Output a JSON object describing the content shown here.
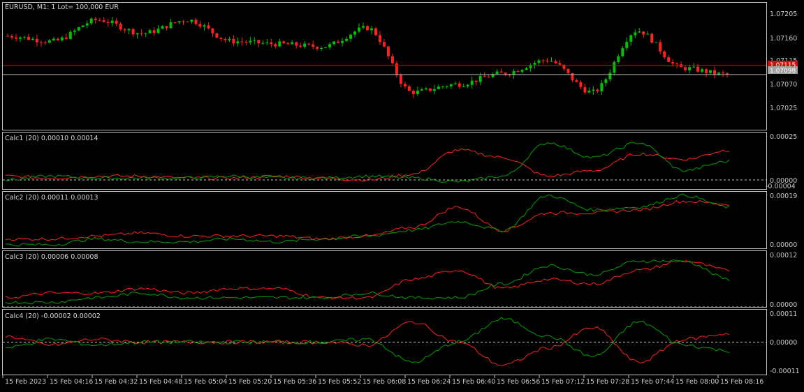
{
  "symbol_header": "EURUSD, M1:  1 Lot= 100,000 EUR",
  "colors": {
    "background": "#000000",
    "frame": "#c0c0c0",
    "bull": "#00c000",
    "bear": "#ff2020",
    "ind_red": "#ff2020",
    "ind_green": "#00a000",
    "bid_line": "#c0c0c0",
    "ask_line": "#d01010",
    "text": "#c8c8c8"
  },
  "main_axis": {
    "ticks": [
      "1.07205",
      "1.07160",
      "1.07115",
      "1.07070",
      "1.07025"
    ],
    "ask_tag": "1.07115",
    "bid_tag": "1.07098"
  },
  "time_axis": [
    "15 Feb 2023",
    "15 Feb 04:16",
    "15 Feb 04:32",
    "15 Feb 04:48",
    "15 Feb 05:04",
    "15 Feb 05:20",
    "15 Feb 05:36",
    "15 Feb 05:52",
    "15 Feb 06:08",
    "15 Feb 06:24",
    "15 Feb 06:40",
    "15 Feb 06:56",
    "15 Feb 07:12",
    "15 Feb 07:28",
    "15 Feb 07:44",
    "15 Feb 08:00",
    "15 Feb 08:16"
  ],
  "indicators": [
    {
      "title": "Calc1 (20) 0.00010 0.00014",
      "axis_top": "0.00025",
      "axis_zero": "0.00000",
      "axis_bottom": "-0.00004"
    },
    {
      "title": "Calc2 (20) 0.00011 0.00013",
      "axis_top": "0.00019",
      "axis_zero": "0.00000"
    },
    {
      "title": "Calc3 (20) 0.00006 0.00008",
      "axis_top": "0.00012",
      "axis_zero": "0.00000"
    },
    {
      "title": "Calc4 (20) -0.00002 0.00002",
      "axis_top": "0.00011",
      "axis_zero": "0.00000",
      "axis_bottom": "-0.00011"
    }
  ],
  "chart_data": [
    {
      "type": "candlestick",
      "title": "EURUSD, M1:  1 Lot= 100,000 EUR",
      "ylim": [
        1.06995,
        1.07232
      ],
      "x": [
        "15 Feb 2023",
        "15 Feb 04:16",
        "15 Feb 04:32",
        "15 Feb 04:48",
        "15 Feb 05:04",
        "15 Feb 05:20",
        "15 Feb 05:36",
        "15 Feb 05:52",
        "15 Feb 06:08",
        "15 Feb 06:24",
        "15 Feb 06:40",
        "15 Feb 06:56",
        "15 Feb 07:12",
        "15 Feb 07:28",
        "15 Feb 07:44",
        "15 Feb 08:00",
        "15 Feb 08:16"
      ],
      "close_anchors": [
        1.0717,
        1.0716,
        1.072,
        1.07175,
        1.072,
        1.0716,
        1.07155,
        1.0715,
        1.07185,
        1.07065,
        1.0708,
        1.071,
        1.07125,
        1.07065,
        1.0718,
        1.0711,
        1.07098
      ],
      "ask": 1.07115,
      "bid": 1.07098
    },
    {
      "type": "line",
      "title": "Calc1 (20) 0.00010 0.00014",
      "ylim": [
        -4.5e-05,
        0.00025
      ],
      "series": [
        {
          "color": "red",
          "anchors": [
            2e-05,
            1e-05,
            2e-05,
            2e-05,
            1e-05,
            1e-05,
            2e-05,
            1e-05,
            0.0,
            3e-05,
            0.00016,
            0.00012,
            2e-05,
            5e-05,
            0.00014,
            0.00011,
            0.00016
          ]
        },
        {
          "color": "green",
          "anchors": [
            0.0,
            2e-05,
            1e-05,
            1e-05,
            1e-05,
            2e-05,
            1e-05,
            1e-05,
            2e-05,
            1e-05,
            -1e-05,
            2e-05,
            0.0002,
            0.00012,
            0.0002,
            5e-05,
            0.0001
          ]
        }
      ]
    },
    {
      "type": "line",
      "title": "Calc2 (20) 0.00011 0.00013",
      "ylim": [
        0,
        0.00019
      ],
      "series": [
        {
          "color": "red",
          "anchors": [
            3e-05,
            3e-05,
            4e-05,
            5e-05,
            4e-05,
            4e-05,
            4e-05,
            3e-05,
            4e-05,
            7e-05,
            0.00014,
            6e-05,
            0.00012,
            0.00012,
            0.00013,
            0.00016,
            0.00015
          ]
        },
        {
          "color": "green",
          "anchors": [
            1e-05,
            1e-05,
            3e-05,
            2e-05,
            2e-05,
            3e-05,
            2e-05,
            3e-05,
            4e-05,
            6e-05,
            9e-05,
            6e-05,
            0.00018,
            0.00013,
            0.00014,
            0.00018,
            0.00014
          ]
        }
      ]
    },
    {
      "type": "line",
      "title": "Calc3 (20) 0.00006 0.00008",
      "ylim": [
        0,
        0.00012
      ],
      "series": [
        {
          "color": "red",
          "anchors": [
            2e-05,
            3e-05,
            3e-05,
            4e-05,
            3e-05,
            4e-05,
            4e-05,
            2e-05,
            2e-05,
            6e-05,
            8e-05,
            4e-05,
            6e-05,
            5e-05,
            8e-05,
            0.0001,
            8e-05
          ]
        },
        {
          "color": "green",
          "anchors": [
            1e-05,
            1e-05,
            2e-05,
            3e-05,
            2e-05,
            2e-05,
            2e-05,
            2e-05,
            3e-05,
            2e-05,
            2e-05,
            5e-05,
            9e-05,
            7e-05,
            0.0001,
            0.0001,
            6e-05
          ]
        }
      ]
    },
    {
      "type": "line",
      "title": "Calc4 (20) -0.00002 0.00002",
      "ylim": [
        -0.00011,
        0.00011
      ],
      "series": [
        {
          "color": "red",
          "anchors": [
            2e-05,
            -1e-05,
            1e-05,
            0.0,
            0.0,
            0.0,
            0.0,
            0.0,
            -1e-05,
            7e-05,
            0.0,
            -8e-05,
            -2e-05,
            5e-05,
            -7e-05,
            1e-05,
            3e-05
          ]
        },
        {
          "color": "green",
          "anchors": [
            -2e-05,
            1e-05,
            -1e-05,
            0.0,
            0.0,
            0.0,
            0.0,
            0.0,
            1e-05,
            -7e-05,
            0.0,
            8e-05,
            2e-05,
            -5e-05,
            7e-05,
            -1e-05,
            -3e-05
          ]
        }
      ]
    }
  ]
}
